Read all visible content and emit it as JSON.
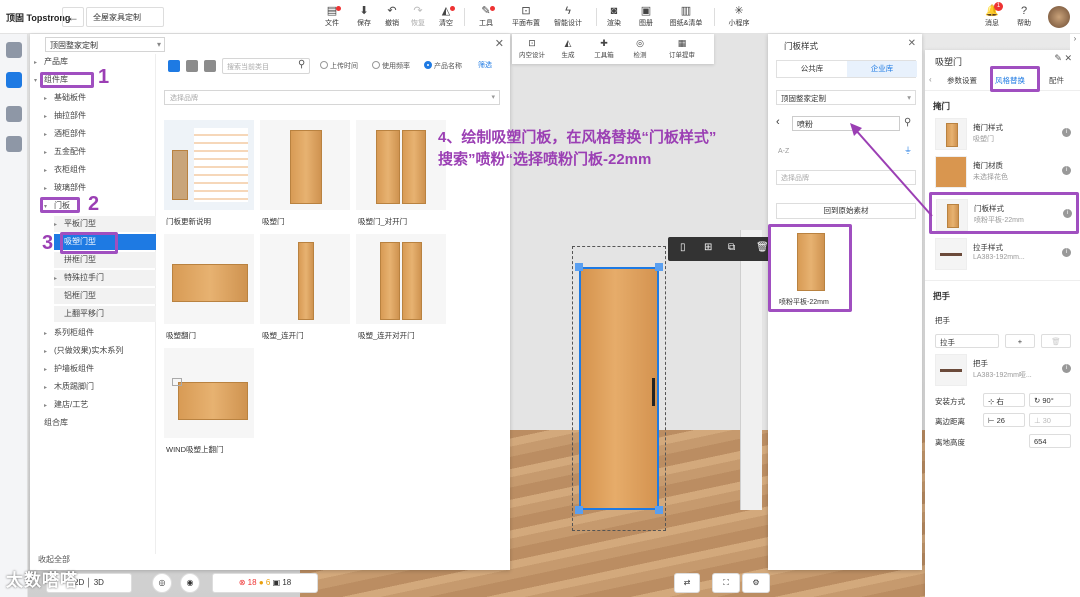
{
  "topbar": {
    "logo": "顶固 Topstrong",
    "project": "全屋家具定制",
    "tools": [
      {
        "label": "文件",
        "icon": "file-icon"
      },
      {
        "label": "保存",
        "icon": "save-icon"
      },
      {
        "label": "撤销",
        "icon": "undo-icon"
      },
      {
        "label": "恢复",
        "icon": "redo-icon"
      },
      {
        "label": "清空",
        "icon": "eraser-icon"
      },
      {
        "label": "工具",
        "icon": "tool-icon"
      },
      {
        "label": "平面布置",
        "icon": "layout-icon"
      },
      {
        "label": "智能设计",
        "icon": "smart-icon"
      },
      {
        "label": "渲染",
        "icon": "camera-icon"
      },
      {
        "label": "图册",
        "icon": "album-icon"
      },
      {
        "label": "图纸&清单",
        "icon": "drawing-icon"
      },
      {
        "label": "小程序",
        "icon": "miniapp-icon"
      }
    ],
    "message": "消息",
    "message_count": "1",
    "help": "帮助"
  },
  "library": {
    "selector": "顶固整家定制",
    "tree": [
      {
        "label": "产品库",
        "level": 0
      },
      {
        "label": "组件库",
        "level": 0
      },
      {
        "label": "基础板件",
        "level": 1
      },
      {
        "label": "抽拉部件",
        "level": 1
      },
      {
        "label": "酒柜部件",
        "level": 1
      },
      {
        "label": "五金配件",
        "level": 1
      },
      {
        "label": "衣柜组件",
        "level": 1
      },
      {
        "label": "玻璃部件",
        "level": 1
      },
      {
        "label": "门板",
        "level": 0
      },
      {
        "label": "平板门型",
        "level": 2
      },
      {
        "label": "吸塑门型",
        "level": 2
      },
      {
        "label": "拼框门型",
        "level": 2
      },
      {
        "label": "特殊拉手门",
        "level": 2
      },
      {
        "label": "铝框门型",
        "level": 2
      },
      {
        "label": "上翻平移门",
        "level": 2
      },
      {
        "label": "系列柜组件",
        "level": 0
      },
      {
        "label": "(只做效果)实木系列",
        "level": 0
      },
      {
        "label": "护墙板组件",
        "level": 0
      },
      {
        "label": "木质踢脚门",
        "level": 0
      },
      {
        "label": "建店/工艺",
        "level": 0
      },
      {
        "label": "组合库",
        "level": 0
      }
    ],
    "collapse_all": "收起全部",
    "search_placeholder": "搜索当前类目",
    "radio_upload": "上传时间",
    "radio_freq": "使用频率",
    "radio_name": "产品名称",
    "filter": "筛选",
    "brand_placeholder": "选择品牌",
    "products": [
      "门板更新说明",
      "吸塑门",
      "吸塑门_对开门",
      "吸塑翻门",
      "吸塑_连开门",
      "吸塑_连开对开门",
      "WIND吸塑上翻门"
    ]
  },
  "canvas_toolbar": [
    "内空设计",
    "生成",
    "工具箱",
    "检测",
    "订单提审"
  ],
  "annotation": {
    "line1": "4、绘制吸塑门板，在风格替换“门板样式”",
    "line2": "搜索”喷粉“选择喷粉门板-22mm",
    "n1": "1",
    "n2": "2",
    "n3": "3"
  },
  "style_panel": {
    "title": "门板样式",
    "tab_public": "公共库",
    "tab_enterprise": "企业库",
    "selector": "顶固整家定制",
    "search_value": "喷粉",
    "sort": "A-Z",
    "brand_placeholder": "选择品牌",
    "back_button": "回到原始素材",
    "result": "喷粉平板-22mm"
  },
  "props": {
    "title": "吸塑门",
    "tab_params": "参数设置",
    "tab_style": "风格替换",
    "tab_parts": "配件",
    "section_door": "掩门",
    "rows": [
      {
        "title": "掩门样式",
        "sub": "吸塑门"
      },
      {
        "title": "掩门材质",
        "sub": "未选择花色"
      },
      {
        "title": "门板样式",
        "sub": "喷粉平板-22mm"
      },
      {
        "title": "拉手样式",
        "sub": "LA383-192mm..."
      }
    ],
    "section_handle": "把手",
    "sub_handle": "把手",
    "handle_type": "拉手",
    "handle_item_title": "把手",
    "handle_item_sub": "LA383-192mm哑...",
    "install_label": "安装方式",
    "install_value": "右",
    "angle_value": "90°",
    "edge_label": "离边距离",
    "edge_value": "26",
    "edge_value2": "30",
    "height_label": "离地高度",
    "height_value": "654"
  },
  "bottom": {
    "error_count": "18",
    "warn_count": "6",
    "item_count": "18",
    "watermark": "太数嗒嗒"
  },
  "colors": {
    "accent": "#1e7ae3",
    "annotation": "#9b3fb4"
  }
}
